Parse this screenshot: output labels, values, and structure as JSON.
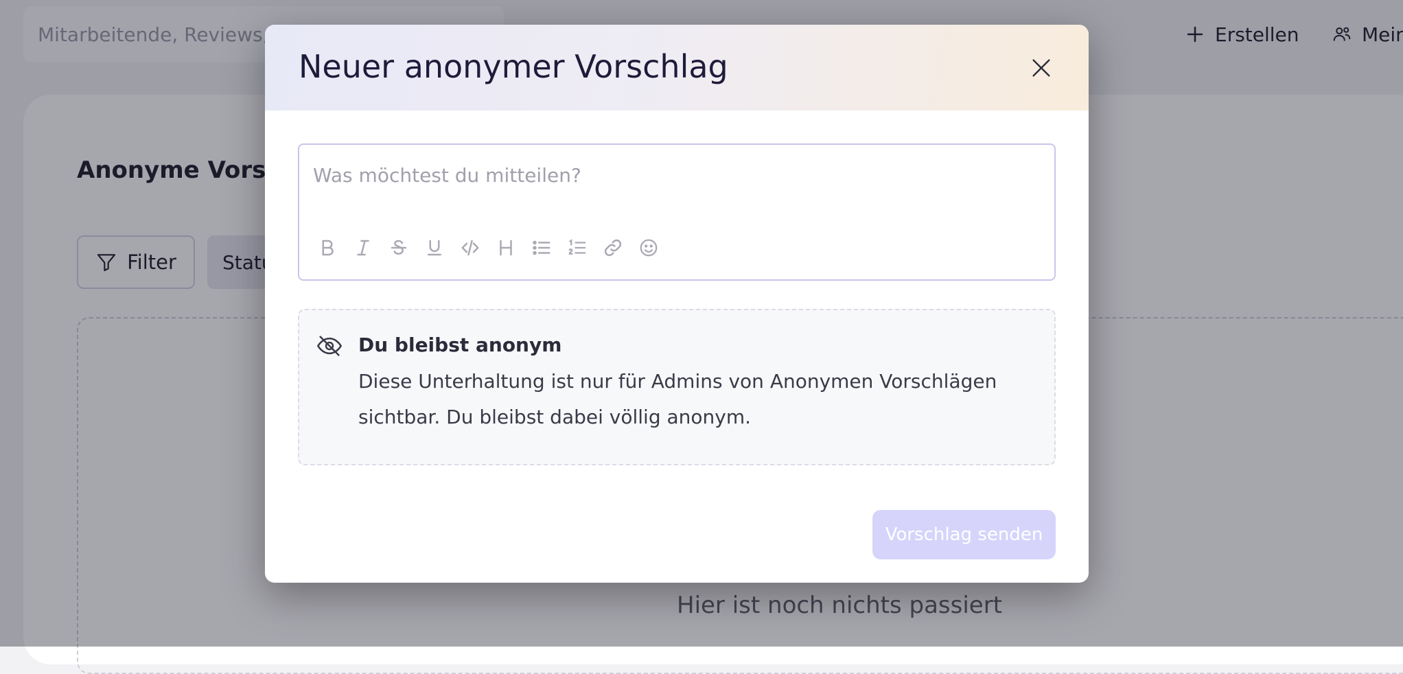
{
  "topbar": {
    "search_placeholder": "Mitarbeitende, Reviews, Ziele…",
    "create_label": "Erstellen",
    "team_label": "Mein Team"
  },
  "page": {
    "title": "Anonyme Vorschläge",
    "filter_label": "Filter",
    "status_label": "Status",
    "empty_text": "Hier ist noch nichts passiert"
  },
  "modal": {
    "title": "Neuer anonymer Vorschlag",
    "editor_placeholder": "Was möchtest du mitteilen?",
    "toolbar": [
      "bold-icon",
      "italic-icon",
      "strikethrough-icon",
      "underline-icon",
      "code-icon",
      "heading-icon",
      "bullet-list-icon",
      "numbered-list-icon",
      "link-icon",
      "emoji-icon"
    ],
    "notice_title": "Du bleibst anonym",
    "notice_text": "Diese Unterhaltung ist nur für Admins von Anonymen Vorschlägen sichtbar. Du bleibst dabei völlig anonym.",
    "submit_label": "Vorschlag senden"
  },
  "colors": {
    "accent": "#d6d4fb",
    "title": "#1e1b3a",
    "overlay": "rgba(20,20,40,0.38)"
  }
}
